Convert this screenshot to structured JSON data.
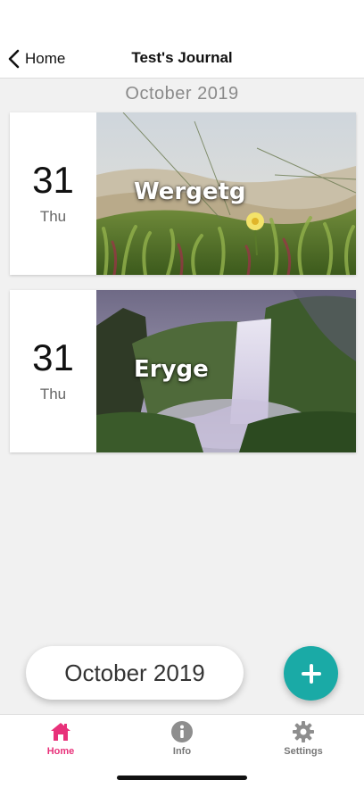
{
  "nav": {
    "back_label": "Home",
    "title": "Test's Journal"
  },
  "month_header": "October 2019",
  "entries": [
    {
      "day": "31",
      "weekday": "Thu",
      "title": "Wergetg"
    },
    {
      "day": "31",
      "weekday": "Thu",
      "title": "Eryge"
    }
  ],
  "month_picker_label": "October 2019",
  "tabs": [
    {
      "label": "Home",
      "icon": "home-icon",
      "active": true
    },
    {
      "label": "Info",
      "icon": "info-icon",
      "active": false
    },
    {
      "label": "Settings",
      "icon": "gear-icon",
      "active": false
    }
  ],
  "colors": {
    "accent": "#e8317a",
    "fab": "#1aaaa6",
    "inactive": "#8e8e8e"
  }
}
